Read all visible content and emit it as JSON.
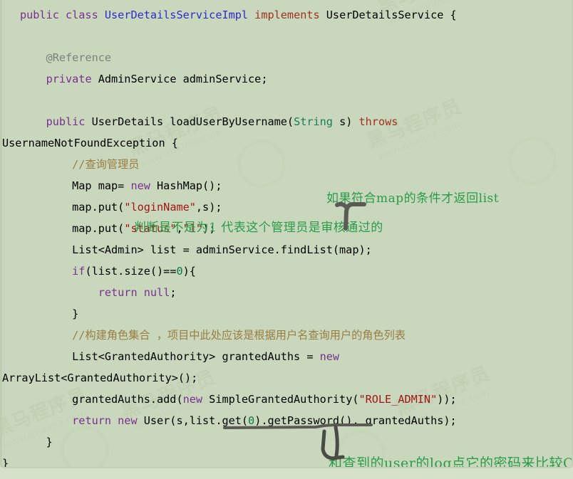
{
  "editor": {
    "background_color": "#c9d8bc",
    "language": "java",
    "code_lines": [
      {
        "id": "line-1",
        "text": "public class UserDetailsServiceImpl implements UserDetailsService {"
      },
      {
        "id": "line-2",
        "text": ""
      },
      {
        "id": "line-3",
        "text": "    @Reference"
      },
      {
        "id": "line-4",
        "text": "    private AdminService adminService;"
      },
      {
        "id": "line-5",
        "text": ""
      },
      {
        "id": "line-6",
        "text": "    public UserDetails loadUserByUsername(String s) throws"
      },
      {
        "id": "line-7",
        "text": "UsernameNotFoundException {"
      },
      {
        "id": "line-8",
        "text": "        //查询管理员"
      },
      {
        "id": "line-9",
        "text": "        Map map= new HashMap();"
      },
      {
        "id": "line-10",
        "text": "        map.put(\"loginName\",s);"
      },
      {
        "id": "line-11",
        "text": "        map.put(\"status\",\"1\");"
      },
      {
        "id": "line-12",
        "text": "        List<Admin> list = adminService.findList(map);"
      },
      {
        "id": "line-13",
        "text": "        if(list.size()==0){"
      },
      {
        "id": "line-14",
        "text": "            return null;"
      },
      {
        "id": "line-15",
        "text": "        }"
      },
      {
        "id": "line-16",
        "text": "        //构建角色集合 ，项目中此处应该是根据用户名查询用户的角色列表"
      },
      {
        "id": "line-17",
        "text": "        List<GrantedAuthority> grantedAuths = new"
      },
      {
        "id": "line-18",
        "text": "ArrayList<GrantedAuthority>();"
      },
      {
        "id": "line-19",
        "text": "        grantedAuths.add(new SimpleGrantedAuthority(\"ROLE_ADMIN\"));"
      },
      {
        "id": "line-20",
        "text": "        return new User(s,list.get(0).getPassword(), grantedAuths);"
      },
      {
        "id": "line-21",
        "text": "    }"
      },
      {
        "id": "line-22",
        "text": "}"
      }
    ],
    "token_colors": {
      "keyword": "#7a2f8f",
      "type_name": "#2b2bd0",
      "implements_keyword": "#a0301f",
      "string_literal": "#a31515",
      "number_literal": "#0a7a4a",
      "comment": "#9a7d42",
      "annotation": "#808080",
      "param_type": "#1c7a5e",
      "plain": "#000000"
    }
  },
  "annotations": {
    "color": "#2a9b4a",
    "notes": [
      {
        "id": "note-top",
        "text": "如果符合map的条件才返回list"
      },
      {
        "id": "note-middle",
        "text": "判断是不是为1  代表这个管理员是审核通过的"
      },
      {
        "id": "note-bottom",
        "text": "和查到的user的log点它的密码来比较OK"
      }
    ],
    "marks": [
      {
        "id": "caret-up-mark",
        "shape": "upward-caret-arrow",
        "color": "#5b5b55"
      },
      {
        "id": "underline-mark",
        "shape": "horizontal-underline",
        "color": "#5b5b55"
      },
      {
        "id": "hook-pointer-mark",
        "shape": "u-turn-hook",
        "color": "#4a4a46"
      }
    ]
  },
  "watermark": {
    "brand_cn": "黑马程序员",
    "url": "www.itheima.com",
    "color": "#bdccae"
  }
}
